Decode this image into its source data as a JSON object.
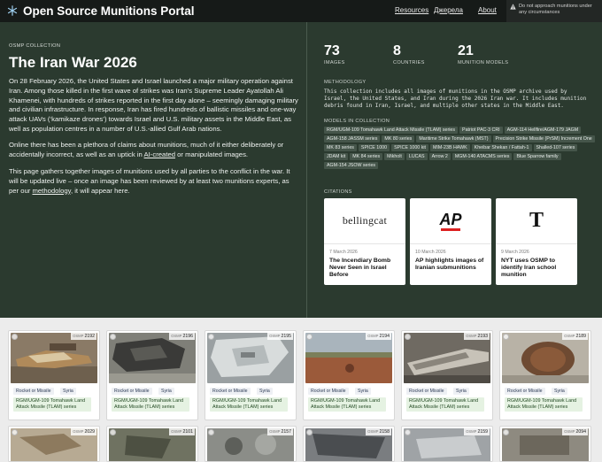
{
  "header": {
    "title": "Open Source Munitions Portal",
    "nav": [
      "Resources",
      "Джерела",
      "About"
    ],
    "warning": "Do not approach munitions under any circumstances"
  },
  "hero": {
    "eyebrow": "OSMP COLLECTION",
    "title": "The Iran War 2026",
    "p1": "On 28 February 2026, the United States and Israel launched a major military operation against Iran. Among those killed in the first wave of strikes was Iran’s Supreme Leader Ayatollah Ali Khamenei, with hundreds of strikes reported in the first day alone – seemingly damaging military and civilian infrastructure. In response, Iran has fired hundreds of ballistic missiles and one-way attack UAVs (‘kamikaze drones’) towards Israel and U.S. military assets in the Middle East, as well as population centres in a number of U.S.-allied Gulf Arab nations.",
    "p2_before": "Online there has been a plethora of claims about munitions, much of it either deliberately or accidentally incorrect, as well as an uptick in ",
    "p2_link": "AI-created",
    "p2_after": " or manipulated images.",
    "p3_before": "This page gathers together images of munitions used by all parties to the conflict in the war. It will be updated live – once an image has been reviewed by at least two munitions experts, as per our ",
    "p3_link": "methodology",
    "p3_after": ", it will appear here."
  },
  "stats": [
    {
      "value": "73",
      "label": "IMAGES"
    },
    {
      "value": "8",
      "label": "COUNTRIES"
    },
    {
      "value": "21",
      "label": "MUNITION MODELS"
    }
  ],
  "methodology": {
    "label": "METHODOLOGY",
    "text": "This collection includes all images of munitions in the OSMP archive used by Israel, the United States, and Iran during the 2026 Iran war. It includes munition debris found in Iran, Israel, and multiple other states in the Middle East."
  },
  "models": {
    "label": "MODELS IN COLLECTION",
    "items": [
      "RGM/UGM-109 Tomahawk Land Attack Missile (TLAM) series",
      "Patriot PAC-3 CRI",
      "AGM-114 Hellfire/AGM-179 JAGM",
      "AGM-158 JASSM series",
      "MK 80 series",
      "Maritime Strike Tomahawk (MST)",
      "Precision Strike Missile (PrSM) Increment One",
      "MK 83 series",
      "SPICE 1000",
      "SPICE 1000 kit",
      "MIM-23B HAWK",
      "Kheibar Shekan / Fattah-1",
      "Shalled-107 series",
      "JDAM kit",
      "MK 84 series",
      "Mikholt",
      "LUCAS",
      "Arrow 2",
      "MGM-140 ATACMS series",
      "Blue Sparrow family",
      "AGM-154 JSOW series"
    ]
  },
  "citations": {
    "label": "CITATIONS",
    "items": [
      {
        "logo": "bellingcat",
        "date": "7 March 2026",
        "title": "The Incendiary Bomb Never Seen in Israel Before"
      },
      {
        "logo": "AP",
        "date": "10 March 2026",
        "title": "AP highlights images of Iranian submunitions"
      },
      {
        "logo": "T",
        "date": "9 March 2026",
        "title": "NYT uses OSMP to identify Iran school munition"
      }
    ]
  },
  "cards": [
    {
      "id": "2192",
      "category": "Rocket or Missile",
      "country": "Syria",
      "model": "RGM/UGM-109 Tomahawk Land Attack Missile (TLAM) series"
    },
    {
      "id": "2196",
      "category": "Rocket or Missile",
      "country": "Syria",
      "model": "RGM/UGM-109 Tomahawk Land Attack Missile (TLAM) series"
    },
    {
      "id": "2195",
      "category": "Rocket or Missile",
      "country": "Syria",
      "model": "RGM/UGM-109 Tomahawk Land Attack Missile (TLAM) series"
    },
    {
      "id": "2194",
      "category": "Rocket or Missile",
      "country": "Syria",
      "model": "RGM/UGM-109 Tomahawk Land Attack Missile (TLAM) series"
    },
    {
      "id": "2193",
      "category": "Rocket or Missile",
      "country": "Syria",
      "model": "RGM/UGM-109 Tomahawk Land Attack Missile (TLAM) series"
    },
    {
      "id": "2189",
      "category": "Rocket or Missile",
      "country": "Syria",
      "model": "RGM/UGM-109 Tomahawk Land Attack Missile (TLAM) series"
    }
  ],
  "cards_row2": [
    {
      "id": "2029"
    },
    {
      "id": "2101"
    },
    {
      "id": "2157"
    },
    {
      "id": "2158"
    },
    {
      "id": "2159"
    },
    {
      "id": "2094"
    }
  ],
  "id_prefix": "OSMP"
}
